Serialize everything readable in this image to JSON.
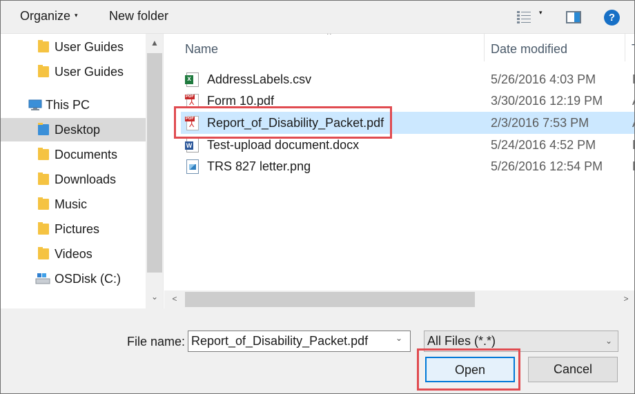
{
  "toolbar": {
    "organize_label": "Organize",
    "organize_caret": "▾",
    "new_folder_label": "New folder",
    "views_caret": "▾",
    "help_label": "?"
  },
  "nav": {
    "items": [
      {
        "label": "User Guides",
        "icon": "folder-icon"
      },
      {
        "label": "User Guides",
        "icon": "folder-icon"
      },
      {
        "label": "This PC",
        "icon": "computer-icon"
      },
      {
        "label": "Desktop",
        "icon": "desktop-folder-icon",
        "selected": true
      },
      {
        "label": "Documents",
        "icon": "documents-folder-icon"
      },
      {
        "label": "Downloads",
        "icon": "downloads-folder-icon"
      },
      {
        "label": "Music",
        "icon": "music-folder-icon"
      },
      {
        "label": "Pictures",
        "icon": "pictures-folder-icon"
      },
      {
        "label": "Videos",
        "icon": "videos-folder-icon"
      },
      {
        "label": "OSDisk (C:)",
        "icon": "drive-icon"
      }
    ],
    "scroll_up": "▲",
    "scroll_down": "⌄"
  },
  "file_list": {
    "columns": {
      "name": "Name",
      "date_modified": "Date modified",
      "type_partial": "T"
    },
    "sort_indicator": "^",
    "rows": [
      {
        "name": "AddressLabels.csv",
        "date": "5/26/2016 4:03 PM",
        "type_partial": "M",
        "icon": "excel-csv-file-icon"
      },
      {
        "name": "Form 10.pdf",
        "date": "3/30/2016 12:19 PM",
        "type_partial": "A",
        "icon": "pdf-file-icon"
      },
      {
        "name": "Report_of_Disability_Packet.pdf",
        "date": "2/3/2016 7:53 PM",
        "type_partial": "A",
        "icon": "pdf-file-icon",
        "selected": true
      },
      {
        "name": "Test-upload document.docx",
        "date": "5/24/2016 4:52 PM",
        "type_partial": "M",
        "icon": "word-document-file-icon"
      },
      {
        "name": "TRS 827 letter.png",
        "date": "5/26/2016 12:54 PM",
        "type_partial": "P",
        "icon": "image-file-icon"
      }
    ],
    "scroll_left": "<",
    "scroll_right": ">"
  },
  "footer": {
    "file_name_label": "File name:",
    "file_name_value": "Report_of_Disability_Packet.pdf",
    "file_name_dropdown": "⌄",
    "file_type_value": "All Files (*.*)",
    "file_type_dropdown": "⌄",
    "open_label": "Open",
    "cancel_label": "Cancel"
  },
  "colors": {
    "highlight_box": "#e04b50",
    "selection": "#cce8ff",
    "accent": "#0078d7"
  }
}
